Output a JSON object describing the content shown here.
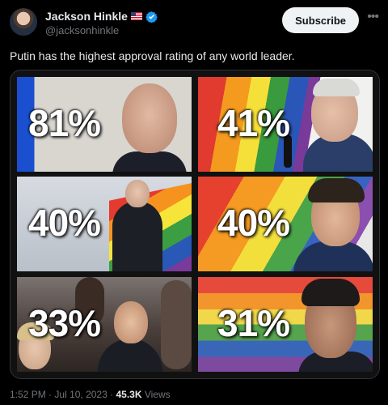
{
  "author": {
    "name": "Jackson Hinkle",
    "handle": "@jacksonhinkle",
    "flag": "us-flag-icon",
    "verified": "verified-badge-icon"
  },
  "subscribe_label": "Subscribe",
  "more_icon": "more-icon",
  "tweet_text": "Putin has the highest approval rating of any world leader.",
  "tiles": [
    {
      "percent": "81%"
    },
    {
      "percent": "41%"
    },
    {
      "percent": "40%"
    },
    {
      "percent": "40%"
    },
    {
      "percent": "33%"
    },
    {
      "percent": "31%"
    }
  ],
  "footer": {
    "time": "1:52 PM",
    "separator": "·",
    "date": "Jul 10, 2023",
    "views_count": "45.3K",
    "views_label": "Views"
  },
  "colors": {
    "background": "#000000",
    "text": "#e7e9ea",
    "muted": "#71767b",
    "verified": "#1d9bf0",
    "subscribe_bg": "#eff3f4"
  }
}
